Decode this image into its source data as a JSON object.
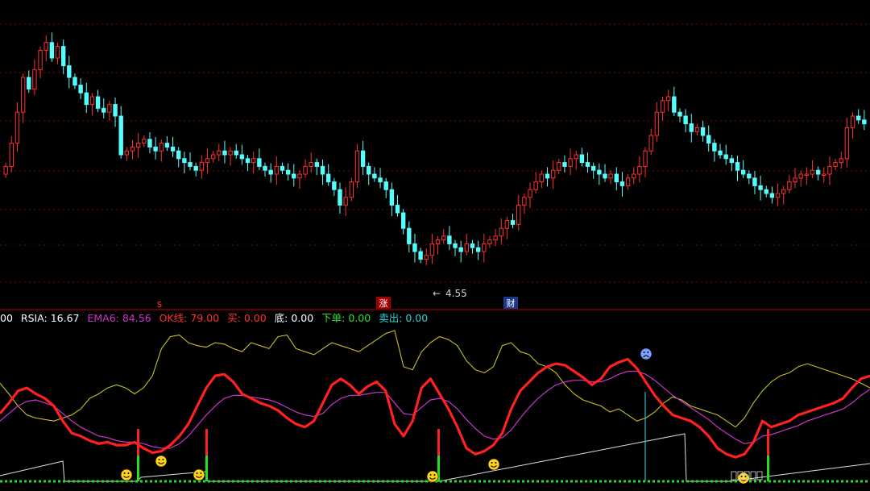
{
  "indicator_bar": {
    "lead": "00",
    "rsia": "RSIA: 16.67",
    "ema6": "EMA6: 84.56",
    "ok": "OK线: 79.00",
    "buy": "买: 0.00",
    "bottom": "底: 0.00",
    "order": "下单: 0.00",
    "sell": "卖出: 0.00"
  },
  "markers": {
    "low_price": "4.55",
    "s_tag": "s",
    "zhang_tag": "涨",
    "cai_tag": "财"
  },
  "colors": {
    "up_candle": "#ff3030",
    "down_candle": "#54ffff",
    "rsia_line": "#ff2020",
    "ema6_line": "#cc33cc",
    "ok_line": "#c8c020",
    "baseline": "#20e020",
    "grid": "#7a0000",
    "divider": "#c00000"
  },
  "chart_data": [
    {
      "type": "candlestick",
      "title": "",
      "annotations": [
        "4.55",
        "s",
        "涨",
        "财"
      ],
      "grid": true,
      "closes": [
        4.82,
        4.88,
        4.96,
        5.05,
        5.02,
        5.07,
        5.12,
        5.14,
        5.1,
        5.13,
        5.08,
        5.05,
        5.03,
        5.01,
        4.98,
        5.0,
        4.97,
        4.96,
        4.98,
        4.95,
        4.85,
        4.86,
        4.87,
        4.88,
        4.89,
        4.87,
        4.86,
        4.88,
        4.87,
        4.86,
        4.84,
        4.83,
        4.82,
        4.81,
        4.83,
        4.84,
        4.85,
        4.86,
        4.85,
        4.86,
        4.85,
        4.84,
        4.83,
        4.84,
        4.82,
        4.81,
        4.8,
        4.82,
        4.81,
        4.8,
        4.79,
        4.8,
        4.82,
        4.83,
        4.82,
        4.8,
        4.78,
        4.76,
        4.72,
        4.74,
        4.78,
        4.86,
        4.82,
        4.8,
        4.79,
        4.78,
        4.76,
        4.72,
        4.7,
        4.66,
        4.62,
        4.6,
        4.58,
        4.59,
        4.62,
        4.63,
        4.64,
        4.62,
        4.61,
        4.6,
        4.62,
        4.61,
        4.6,
        4.62,
        4.63,
        4.64,
        4.66,
        4.68,
        4.67,
        4.72,
        4.74,
        4.76,
        4.78,
        4.8,
        4.79,
        4.81,
        4.83,
        4.82,
        4.84,
        4.85,
        4.83,
        4.82,
        4.81,
        4.8,
        4.79,
        4.8,
        4.78,
        4.77,
        4.79,
        4.8,
        4.82,
        4.86,
        4.9,
        4.96,
        4.99,
        5.0,
        4.96,
        4.95,
        4.93,
        4.91,
        4.92,
        4.9,
        4.88,
        4.86,
        4.85,
        4.84,
        4.83,
        4.81,
        4.8,
        4.79,
        4.77,
        4.76,
        4.75,
        4.74,
        4.75,
        4.76,
        4.78,
        4.79,
        4.8,
        4.8,
        4.81,
        4.8,
        4.8,
        4.82,
        4.83,
        4.84,
        4.92,
        4.95,
        4.94,
        4.93
      ]
    },
    {
      "type": "line",
      "title": "",
      "ylim": [
        0,
        100
      ],
      "series": [
        {
          "name": "RSIA",
          "values": [
            45,
            52,
            60,
            62,
            58,
            55,
            50,
            40,
            32,
            30,
            27,
            25,
            26,
            24,
            24,
            26,
            22,
            19,
            20,
            24,
            30,
            38,
            50,
            62,
            70,
            71,
            66,
            58,
            55,
            52,
            50,
            47,
            42,
            38,
            36,
            40,
            52,
            64,
            68,
            64,
            58,
            63,
            66,
            60,
            38,
            30,
            40,
            62,
            68,
            58,
            48,
            36,
            22,
            18,
            20,
            24,
            32,
            48,
            60,
            66,
            72,
            76,
            78,
            77,
            73,
            69,
            64,
            68,
            76,
            79,
            81,
            75,
            66,
            57,
            50,
            44,
            42,
            40,
            36,
            30,
            22,
            18,
            16,
            18,
            26,
            40,
            36,
            38,
            40,
            44,
            46,
            48,
            50,
            52,
            55,
            62,
            68,
            70
          ]
        },
        {
          "name": "EMA6",
          "values": [
            40,
            45,
            50,
            53,
            54,
            52,
            50,
            45,
            40,
            36,
            33,
            30,
            29,
            27,
            26,
            26,
            25,
            23,
            22,
            22,
            25,
            30,
            37,
            44,
            50,
            55,
            57,
            57,
            56,
            55,
            54,
            52,
            49,
            46,
            44,
            43,
            45,
            51,
            55,
            57,
            57,
            58,
            59,
            59,
            52,
            45,
            44,
            49,
            54,
            55,
            53,
            48,
            41,
            35,
            30,
            28,
            29,
            34,
            42,
            49,
            55,
            60,
            64,
            66,
            67,
            67,
            66,
            66,
            68,
            71,
            73,
            73,
            71,
            67,
            62,
            57,
            53,
            49,
            45,
            41,
            36,
            32,
            28,
            25,
            26,
            30,
            31,
            33,
            35,
            37,
            40,
            42,
            44,
            46,
            48,
            52,
            57,
            61
          ]
        },
        {
          "name": "OK线",
          "values": [
            65,
            58,
            50,
            44,
            42,
            41,
            40,
            42,
            44,
            48,
            55,
            58,
            62,
            64,
            62,
            58,
            62,
            70,
            88,
            96,
            97,
            92,
            90,
            89,
            92,
            91,
            88,
            86,
            92,
            90,
            88,
            96,
            97,
            88,
            86,
            84,
            88,
            92,
            90,
            88,
            86,
            90,
            94,
            98,
            100,
            76,
            74,
            86,
            92,
            96,
            94,
            90,
            80,
            74,
            72,
            76,
            90,
            92,
            86,
            84,
            78,
            76,
            72,
            64,
            58,
            54,
            52,
            50,
            46,
            48,
            44,
            40,
            42,
            46,
            52,
            56,
            54,
            50,
            48,
            46,
            44,
            40,
            36,
            42,
            52,
            60,
            66,
            70,
            72,
            76,
            78,
            76,
            74,
            72,
            70,
            68,
            65,
            62
          ]
        }
      ]
    }
  ]
}
